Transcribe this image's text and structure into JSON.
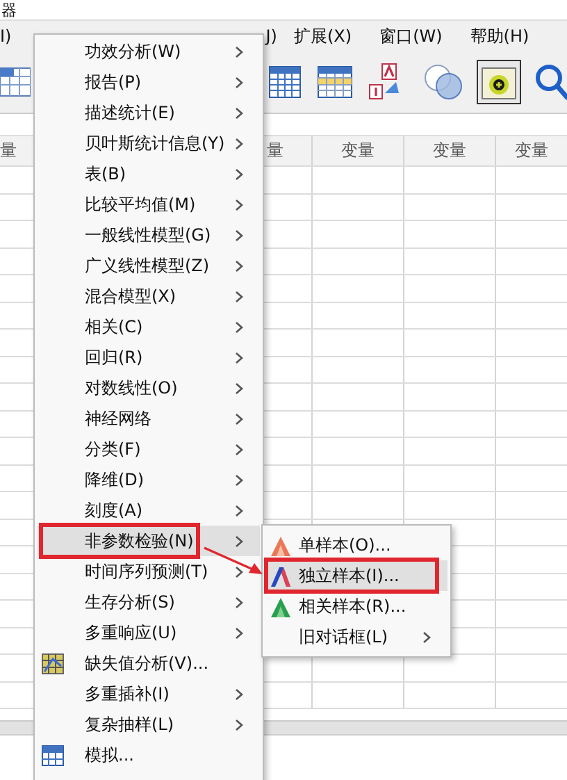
{
  "window": {
    "title": "器"
  },
  "menu_bar": [
    {
      "label": "I)"
    },
    {
      "label": "J)"
    },
    {
      "label": "扩展(X)"
    },
    {
      "label": "窗口(W)"
    },
    {
      "label": "帮助(H)"
    }
  ],
  "toolbar": [
    {
      "kind": "grid",
      "pressed": false
    },
    {
      "kind": "table-blue",
      "pressed": false
    },
    {
      "kind": "table-yellow",
      "pressed": false
    },
    {
      "kind": "label",
      "pressed": false
    },
    {
      "kind": "circles",
      "pressed": false
    },
    {
      "kind": "target",
      "pressed": true
    },
    {
      "kind": "search",
      "pressed": false
    }
  ],
  "table": {
    "columns": [
      "量",
      "量",
      "变量",
      "变量",
      "变量"
    ]
  },
  "menu": {
    "items": [
      {
        "label": "功效分析(W)",
        "kind": "submenu",
        "selected": false
      },
      {
        "label": "报告(P)",
        "kind": "submenu",
        "selected": false
      },
      {
        "label": "描述统计(E)",
        "kind": "submenu",
        "selected": false
      },
      {
        "label": "贝叶斯统计信息(Y)",
        "kind": "submenu",
        "selected": false
      },
      {
        "label": "表(B)",
        "kind": "submenu",
        "selected": false
      },
      {
        "label": "比较平均值(M)",
        "kind": "submenu",
        "selected": false
      },
      {
        "label": "一般线性模型(G)",
        "kind": "submenu",
        "selected": false
      },
      {
        "label": "广义线性模型(Z)",
        "kind": "submenu",
        "selected": false
      },
      {
        "label": "混合模型(X)",
        "kind": "submenu",
        "selected": false
      },
      {
        "label": "相关(C)",
        "kind": "submenu",
        "selected": false
      },
      {
        "label": "回归(R)",
        "kind": "submenu",
        "selected": false
      },
      {
        "label": "对数线性(O)",
        "kind": "submenu",
        "selected": false
      },
      {
        "label": "神经网络",
        "kind": "submenu",
        "selected": false
      },
      {
        "label": "分类(F)",
        "kind": "submenu",
        "selected": false
      },
      {
        "label": "降维(D)",
        "kind": "submenu",
        "selected": false
      },
      {
        "label": "刻度(A)",
        "kind": "submenu",
        "selected": false
      },
      {
        "label": "非参数检验(N)",
        "kind": "submenu",
        "selected": true
      },
      {
        "label": "时间序列预测(T)",
        "kind": "submenu",
        "selected": false
      },
      {
        "label": "生存分析(S)",
        "kind": "submenu",
        "selected": false
      },
      {
        "label": "多重响应(U)",
        "kind": "submenu",
        "selected": false
      },
      {
        "label": "缺失值分析(V)...",
        "kind": "command",
        "selected": false
      },
      {
        "label": "多重插补(I)",
        "kind": "submenu",
        "selected": false
      },
      {
        "label": "复杂抽样(L)",
        "kind": "submenu",
        "selected": false
      },
      {
        "label": "模拟...",
        "kind": "command",
        "selected": false
      }
    ]
  },
  "submenu": {
    "items": [
      {
        "label": "单样本(O)...",
        "kind": "command",
        "selected": false
      },
      {
        "label": "独立样本(I)...",
        "kind": "command",
        "selected": true
      },
      {
        "label": "相关样本(R)...",
        "kind": "command",
        "selected": false
      },
      {
        "label": "旧对话框(L)",
        "kind": "submenu",
        "selected": false
      }
    ]
  }
}
